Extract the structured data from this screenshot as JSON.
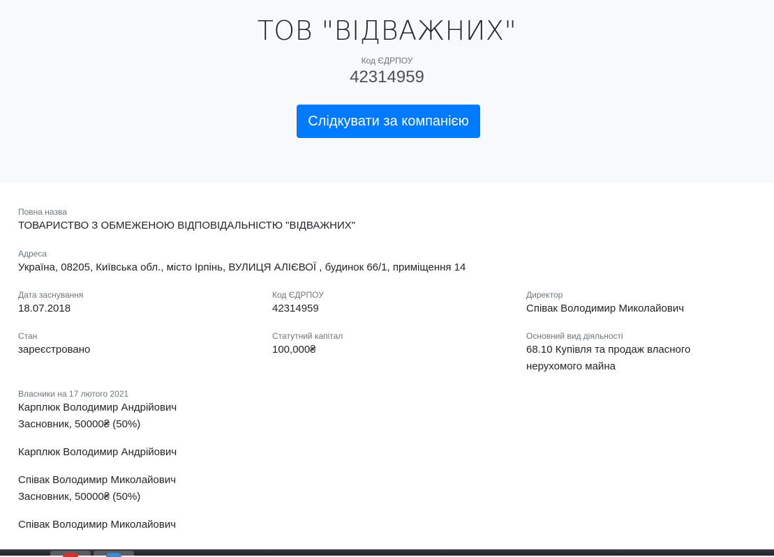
{
  "header": {
    "company_short_name": "ТОВ \"ВІДВАЖНИХ\"",
    "edrpou_label": "Код ЄДРПОУ",
    "edrpou_value": "42314959",
    "follow_button": "Слідкувати за компанією",
    "accent_color": "#007bff"
  },
  "details": {
    "full_name": {
      "label": "Повна назва",
      "value": "ТОВАРИСТВО З ОБМЕЖЕНОЮ ВІДПОВІДАЛЬНІСТЮ \"ВІДВАЖНИХ\""
    },
    "address": {
      "label": "Адреса",
      "value": "Україна, 08205, Київська обл., місто Ірпінь, ВУЛИЦЯ АЛІЄВОЇ , будинок 66/1, приміщення 14"
    },
    "founded": {
      "label": "Дата заснування",
      "value": "18.07.2018"
    },
    "edrpou": {
      "label": "Код ЄДРПОУ",
      "value": "42314959"
    },
    "director": {
      "label": "Директор",
      "value": "Співак Володимир Миколайович"
    },
    "status": {
      "label": "Стан",
      "value": "зареєстровано"
    },
    "capital": {
      "label": "Статутний капітал",
      "value": "100,000₴"
    },
    "activity": {
      "label": "Основний вид діяльності",
      "line1": "68.10 Купівля та продаж власного",
      "line2": "нерухомого майна"
    }
  },
  "owners": {
    "label": "Власники на 17 лютого 2021",
    "items": [
      {
        "name": "Карплюк Володимир Андрійович",
        "role": "Засновник, 50000₴ (50%)"
      },
      {
        "name": "Карплюк Володимир Андрійович",
        "role": ""
      },
      {
        "name": "Співак Володимир Миколайович",
        "role": "Засновник, 50000₴ (50%)"
      },
      {
        "name": "Співак Володимир Миколайович",
        "role": ""
      }
    ]
  },
  "taskbar": {
    "icons": [
      "browser-icon-red",
      "browser-icon-blue"
    ]
  }
}
